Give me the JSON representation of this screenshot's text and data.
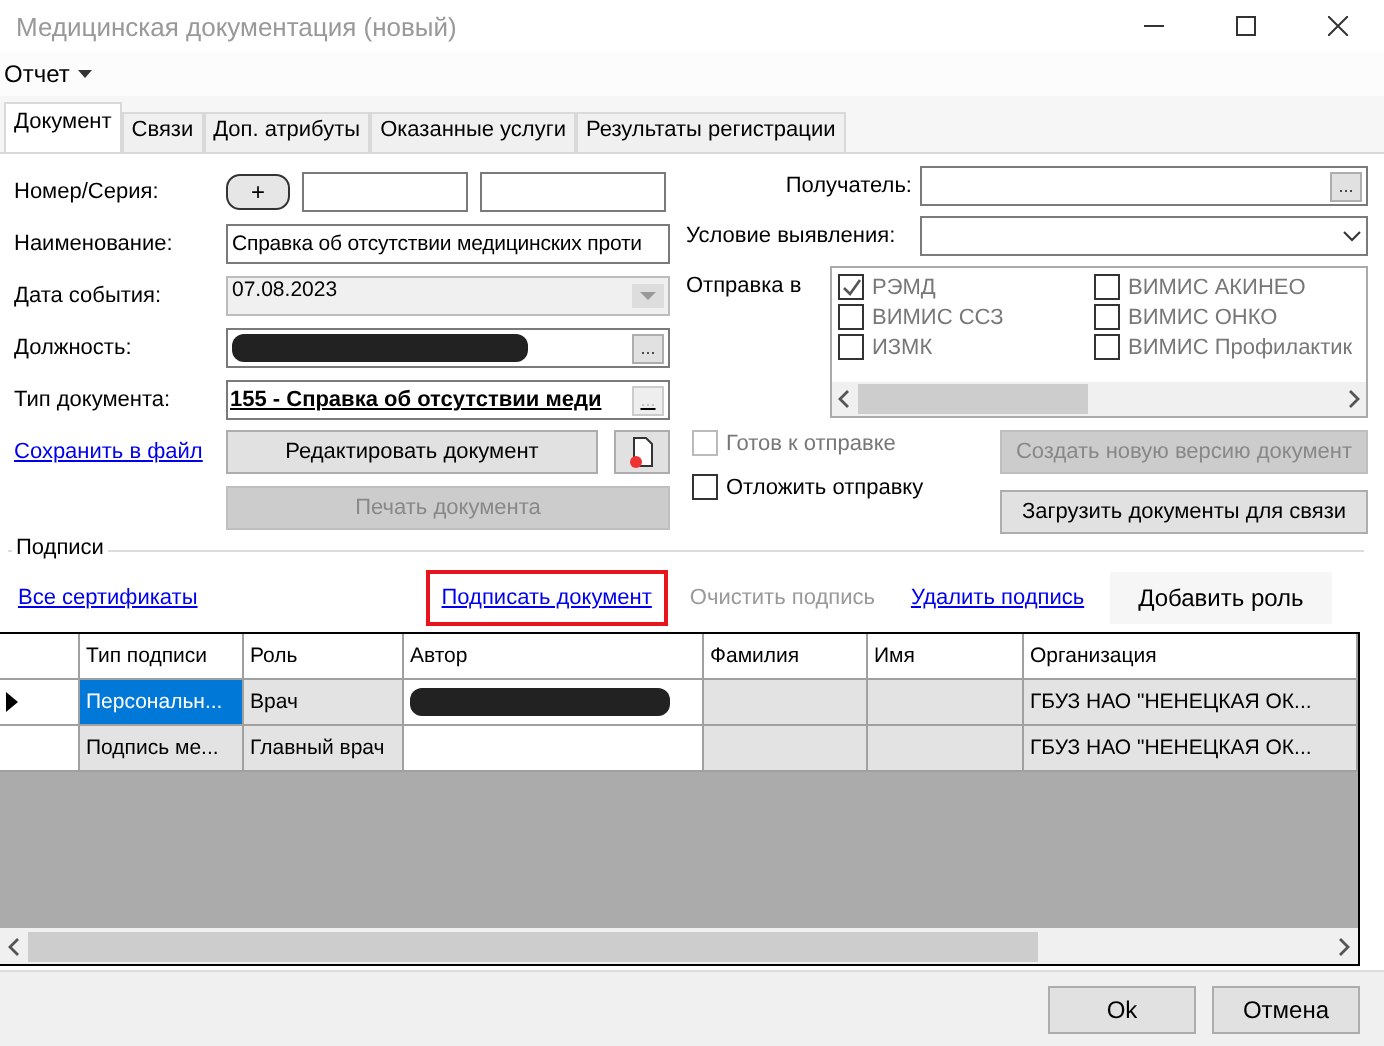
{
  "window": {
    "title": "Медицинская документация (новый)"
  },
  "menu": [
    {
      "label": "Отчет"
    }
  ],
  "tabs": [
    {
      "label": "Документ",
      "selected": true
    },
    {
      "label": "Связи",
      "selected": false
    },
    {
      "label": "Доп. атрибуты",
      "selected": false
    },
    {
      "label": "Оказанные услуги",
      "selected": false
    },
    {
      "label": "Результаты регистрации",
      "selected": false
    }
  ],
  "document": {
    "number_series": {
      "label": "Номер/Серия:",
      "button": "+"
    },
    "name": {
      "label": "Наименование:",
      "value": "Справка об отсутствии медицинских проти"
    },
    "event_date": {
      "label": "Дата события:",
      "value": "07.08.2023"
    },
    "position": {
      "label": "Должность:",
      "redacted": true,
      "browse_button": "..."
    },
    "doc_type": {
      "label": "Тип документа:",
      "value": "155 - Справка об отсутствии меди",
      "browse_button": "..."
    },
    "save_link": "Сохранить в файл",
    "edit_button": "Редактировать документ",
    "print_button": {
      "label": "Печать документа",
      "disabled": true
    }
  },
  "recipient": {
    "label": "Получатель:",
    "browse_button": "..."
  },
  "detection": {
    "label": "Условие выявления:"
  },
  "send_to": {
    "label": "Отправка в",
    "disabled": true,
    "options": [
      {
        "label": "РЭМД",
        "checked": true
      },
      {
        "label": "ВИМИС ССЗ",
        "checked": false
      },
      {
        "label": "ИЗМК",
        "checked": false
      },
      {
        "label": "ВИМИС АКИНЕО",
        "checked": false
      },
      {
        "label": "ВИМИС ОНКО",
        "checked": false
      },
      {
        "label": "ВИМИС Профилактик",
        "checked": false
      }
    ]
  },
  "ready": {
    "label": "Готов к отправке",
    "checked": false,
    "disabled": true
  },
  "postpone": {
    "label": "Отложить отправку",
    "checked": false,
    "disabled": false
  },
  "new_version_button": {
    "label": "Создать новую версию документ",
    "disabled": true
  },
  "load_button": {
    "label": "Загрузить документы для связи",
    "disabled": false
  },
  "signatures": {
    "title": "Подписи",
    "all_certs": "Все сертификаты",
    "actions": [
      {
        "label": "Подписать документ",
        "disabled": false,
        "highlighted": true
      },
      {
        "label": "Очистить подпись",
        "disabled": true,
        "highlighted": false
      },
      {
        "label": "Удалить подпись",
        "disabled": false,
        "highlighted": false
      }
    ],
    "add_role": "Добавить роль",
    "columns": [
      "Тип подписи",
      "Роль",
      "Автор",
      "Фамилия",
      "Имя",
      "Организация"
    ],
    "rows": [
      {
        "current": true,
        "cells": [
          {
            "text": "Персональн...",
            "selected": true
          },
          {
            "text": "Врач",
            "selected": false
          },
          {
            "redacted": true,
            "selected": false
          },
          {
            "text": "",
            "selected": false
          },
          {
            "text": "",
            "selected": false
          },
          {
            "text": "ГБУЗ НАО \"НЕНЕЦКАЯ ОК...",
            "selected": false
          }
        ]
      },
      {
        "current": false,
        "cells": [
          {
            "text": "Подпись ме...",
            "selected": false
          },
          {
            "text": "Главный врач",
            "selected": false
          },
          {
            "redacted": false,
            "selected": false
          },
          {
            "text": "",
            "selected": false
          },
          {
            "text": "",
            "selected": false
          },
          {
            "text": "ГБУЗ НАО \"НЕНЕЦКАЯ ОК...",
            "selected": false
          }
        ]
      }
    ]
  },
  "footer": {
    "buttons": [
      "Ok",
      "Отмена"
    ]
  }
}
